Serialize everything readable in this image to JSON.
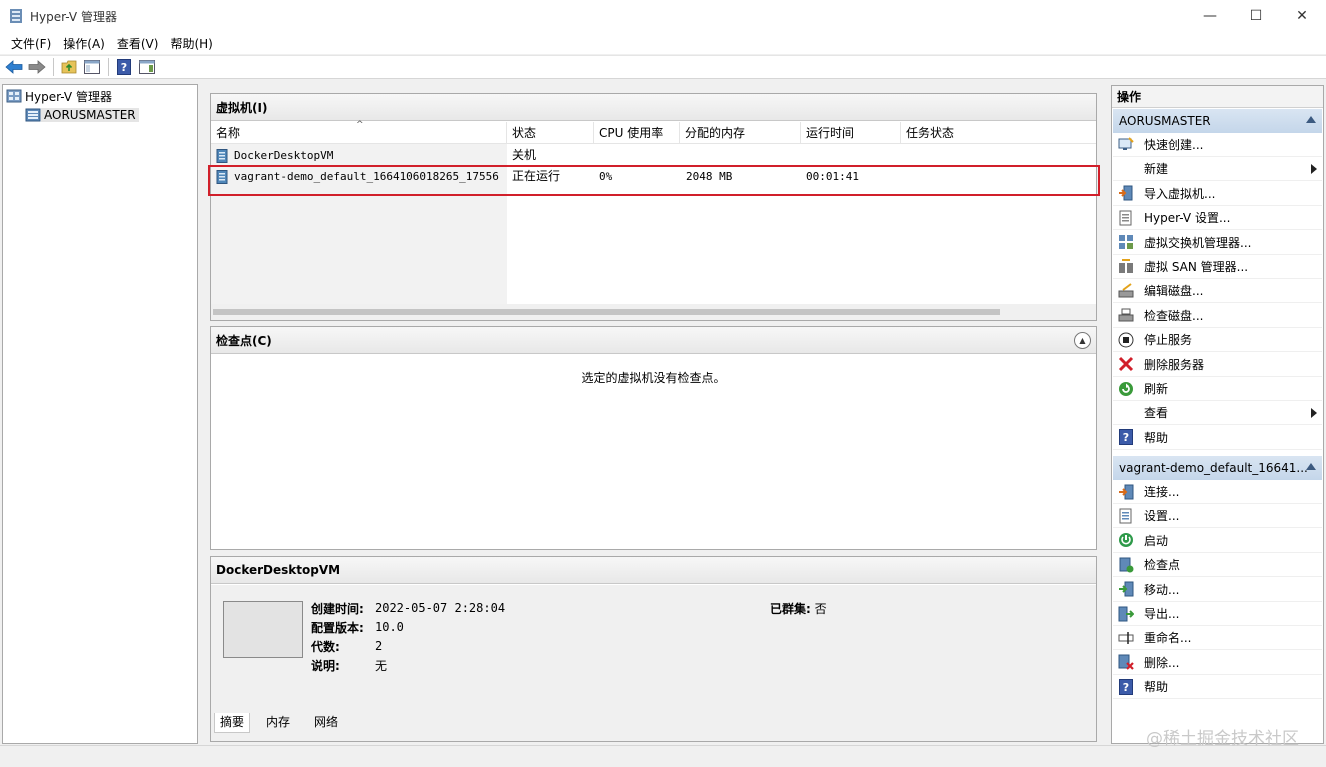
{
  "window": {
    "title": "Hyper-V 管理器",
    "min_glyph": "—",
    "max_glyph": "☐",
    "close_glyph": "✕"
  },
  "menu": [
    "文件(F)",
    "操作(A)",
    "查看(V)",
    "帮助(H)"
  ],
  "toolbar": [
    "back-arrow-icon",
    "forward-arrow-icon",
    "up-folder-icon",
    "show-hide-tree-icon",
    "help-icon",
    "show-hide-action-pane-icon"
  ],
  "tree": {
    "root": "Hyper-V 管理器",
    "server": "AORUSMASTER"
  },
  "vm_panel": {
    "title": "虚拟机(I)",
    "columns": [
      "名称",
      "状态",
      "CPU 使用率",
      "分配的内存",
      "运行时间",
      "任务状态"
    ],
    "rows": [
      {
        "name": "DockerDesktopVM",
        "state": "关机",
        "cpu": "",
        "memory": "",
        "uptime": "",
        "task": ""
      },
      {
        "name": "vagrant-demo_default_1664106018265_17556",
        "state": "正在运行",
        "cpu": "0%",
        "memory": "2048 MB",
        "uptime": "00:01:41",
        "task": ""
      }
    ],
    "highlight_color": "#d11f2a"
  },
  "checkpoint_panel": {
    "title": "检查点(C)",
    "empty_text": "选定的虚拟机没有检查点。"
  },
  "details_panel": {
    "title": "DockerDesktopVM",
    "created_label": "创建时间:",
    "created_value": "2022-05-07 2:28:04",
    "config_label": "配置版本:",
    "config_value": "10.0",
    "gen_label": "代数:",
    "gen_value": "2",
    "notes_label": "说明:",
    "notes_value": "无",
    "clustered_label": "已群集:",
    "clustered_value": "否",
    "tabs": [
      "摘要",
      "内存",
      "网络"
    ]
  },
  "actions": {
    "title": "操作",
    "server_section": "AORUSMASTER",
    "server_items": [
      {
        "label": "快速创建...",
        "icon": "quick-create-icon"
      },
      {
        "label": "新建",
        "icon": "none",
        "submenu": true
      },
      {
        "label": "导入虚拟机...",
        "icon": "import-vm-icon"
      },
      {
        "label": "Hyper-V 设置...",
        "icon": "hyperv-settings-icon"
      },
      {
        "label": "虚拟交换机管理器...",
        "icon": "virtual-switch-icon"
      },
      {
        "label": "虚拟 SAN 管理器...",
        "icon": "virtual-san-icon"
      },
      {
        "label": "编辑磁盘...",
        "icon": "edit-disk-icon"
      },
      {
        "label": "检查磁盘...",
        "icon": "inspect-disk-icon"
      },
      {
        "label": "停止服务",
        "icon": "stop-service-icon"
      },
      {
        "label": "删除服务器",
        "icon": "remove-server-icon"
      },
      {
        "label": "刷新",
        "icon": "refresh-icon"
      },
      {
        "label": "查看",
        "icon": "none",
        "submenu": true
      },
      {
        "label": "帮助",
        "icon": "help-icon"
      }
    ],
    "vm_section": "vagrant-demo_default_16641...",
    "vm_items": [
      {
        "label": "连接...",
        "icon": "connect-icon"
      },
      {
        "label": "设置...",
        "icon": "settings-icon"
      },
      {
        "label": "启动",
        "icon": "start-icon"
      },
      {
        "label": "检查点",
        "icon": "checkpoint-icon"
      },
      {
        "label": "移动...",
        "icon": "move-icon"
      },
      {
        "label": "导出...",
        "icon": "export-icon"
      },
      {
        "label": "重命名...",
        "icon": "rename-icon"
      },
      {
        "label": "删除...",
        "icon": "delete-icon"
      },
      {
        "label": "帮助",
        "icon": "help-icon"
      }
    ]
  },
  "watermark": "@稀土掘金技术社区"
}
